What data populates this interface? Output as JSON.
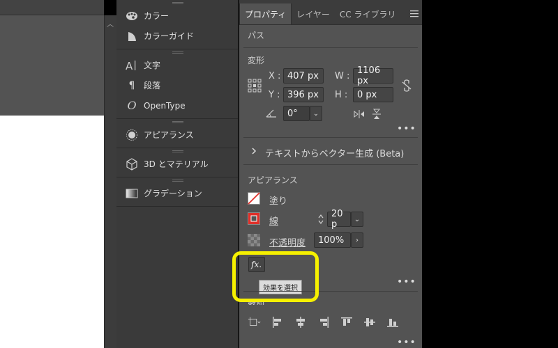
{
  "mid_panel": {
    "groups": [
      {
        "items": [
          {
            "label": "カラー",
            "icon": "palette-icon"
          },
          {
            "label": "カラーガイド",
            "icon": "color-guide-icon"
          }
        ]
      },
      {
        "items": [
          {
            "label": "文字",
            "icon": "character-icon"
          },
          {
            "label": "段落",
            "icon": "paragraph-icon"
          },
          {
            "label": "OpenType",
            "icon": "opentype-icon"
          }
        ]
      },
      {
        "items": [
          {
            "label": "アピアランス",
            "icon": "appearance-icon"
          }
        ]
      },
      {
        "items": [
          {
            "label": "3D とマテリアル",
            "icon": "3d-cube-icon"
          }
        ]
      },
      {
        "items": [
          {
            "label": "グラデーション",
            "icon": "gradient-icon"
          }
        ]
      }
    ]
  },
  "tabs": {
    "properties": "プロパティ",
    "layers": "レイヤー",
    "cc_libraries": "CC ライブラリ"
  },
  "props": {
    "path_label": "パス",
    "transform": {
      "title": "変形",
      "x_label": "X :",
      "x_value": "407 px",
      "y_label": "Y :",
      "y_value": "396 px",
      "w_label": "W :",
      "w_value": "1106 px",
      "h_label": "H :",
      "h_value": "0 px",
      "angle_value": "0°"
    },
    "text_to_vector": "テキストからベクター生成 (Beta)",
    "appearance": {
      "title": "アピアランス",
      "fill_label": "塗り",
      "stroke_label": "線",
      "stroke_value": "20 p",
      "opacity_label": "不透明度",
      "opacity_value": "100%"
    },
    "fx_label": "fx.",
    "tooltip": "効果を選択",
    "align_title": "整列"
  },
  "colors": {
    "highlight": "#f6f000",
    "stroke_red": "#e0302a"
  }
}
